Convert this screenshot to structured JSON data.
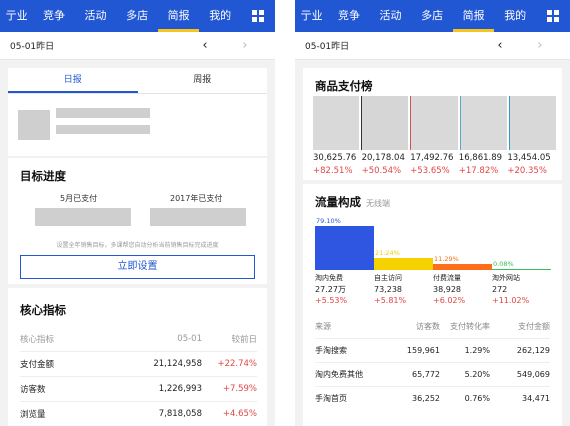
{
  "left": {
    "nav": {
      "items": [
        "行业",
        "竞争",
        "活动",
        "多店",
        "简报",
        "我的"
      ],
      "active": 4,
      "first_clip": "亍业"
    },
    "date": "05-01昨日",
    "tabs": [
      "日报",
      "周报"
    ],
    "target": {
      "title": "目标进度",
      "col1": "5月已支付",
      "col2": "2017年已支付",
      "hint": "设置全年销售目标，多课帮您自动分析当前销售目标完成进度",
      "button": "立即设置"
    },
    "core": {
      "title": "核心指标",
      "header": [
        "核心指标",
        "05-01",
        "较前日"
      ],
      "rows": [
        {
          "label": "支付金额",
          "value": "21,124,958",
          "change": "+22.74%"
        },
        {
          "label": "访客数",
          "value": "1,226,993",
          "change": "+7.59%"
        },
        {
          "label": "浏览量",
          "value": "7,818,058",
          "change": "+4.65%"
        }
      ]
    }
  },
  "right": {
    "nav": {
      "items": [
        "行业",
        "竞争",
        "活动",
        "多店",
        "简报",
        "我的"
      ],
      "active": 4
    },
    "date": "05-01昨日",
    "products": {
      "title": "商品支付榜",
      "values": [
        "30,625.76",
        "20,178.04",
        "17,492.76",
        "16,861.89",
        "13,454.05"
      ],
      "changes": [
        "+82.51%",
        "+50.54%",
        "+53.65%",
        "+17.82%",
        "+20.35%"
      ]
    },
    "traffic": {
      "title": "流量构成",
      "subtitle": "无线端",
      "chart_data": {
        "type": "bar",
        "categories": [
          "淘内免费",
          "自主访问",
          "付费流量",
          "淘外网站"
        ],
        "values": [
          79.1,
          21.24,
          11.29,
          0.08
        ],
        "percent_labels": [
          "79.10%",
          "21.24%",
          "11.29%",
          "0.08%"
        ],
        "counts": [
          "27.27万",
          "73,238",
          "38,928",
          "272"
        ],
        "changes": [
          "+5.53%",
          "+5.81%",
          "+6.02%",
          "+11.02%"
        ],
        "colors": [
          "#2f56e0",
          "#f5d100",
          "#ff6d1a",
          "#37c05a"
        ]
      },
      "table": {
        "header": [
          "来源",
          "访客数",
          "支付转化率",
          "支付金额"
        ],
        "rows": [
          {
            "source": "手淘搜索",
            "visitors": "159,961",
            "rate": "1.29%",
            "amount": "262,129"
          },
          {
            "source": "淘内免费其他",
            "visitors": "65,772",
            "rate": "5.20%",
            "amount": "549,069"
          },
          {
            "source": "手淘首页",
            "visitors": "36,252",
            "rate": "0.76%",
            "amount": "34,471"
          }
        ]
      }
    }
  }
}
